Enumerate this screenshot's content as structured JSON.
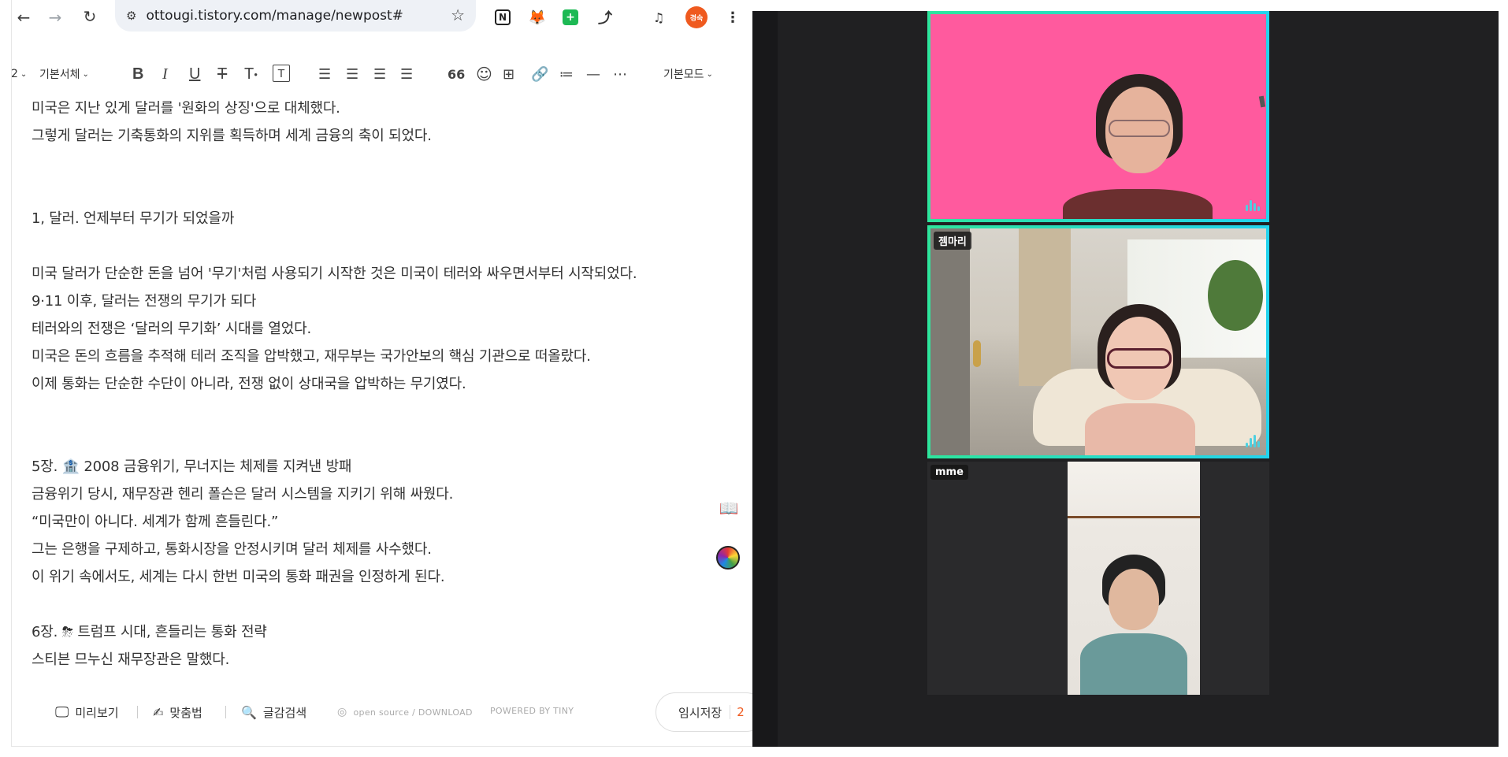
{
  "browser": {
    "url": "ottougi.tistory.com/manage/newpost#",
    "nav": {
      "back": "←",
      "forward": "→",
      "reload": "↻"
    },
    "profile_badge": "경숙"
  },
  "toolbar": {
    "heading_select": "2",
    "font_select": "기본서체",
    "mode_select": "기본모드",
    "bold": "B",
    "italic": "I",
    "underline": "U",
    "strike": "T",
    "text_color": "T",
    "text_bg": "T",
    "quote": "66"
  },
  "content": {
    "lines": [
      "미국은 지난 있게 달러를 '원화의 상징'으로 대체했다.",
      "그렇게 달러는 기축통화의 지위를 획득하며 세계 금융의 축이 되었다.",
      "",
      "",
      "1,  달러. 언제부터 무기가 되었을까",
      "",
      "미국 달러가 단순한 돈을 넘어 '무기'처럼 사용되기 시작한 것은 미국이  테러와 싸우면서부터 시작되었다.",
      "9·11 이후, 달러는 전쟁의 무기가 되다",
      "테러와의 전쟁은 ‘달러의 무기화’ 시대를 열었다.",
      "미국은 돈의 흐름을 추적해 테러 조직을 압박했고, 재무부는 국가안보의 핵심 기관으로 떠올랐다.",
      "이제 통화는 단순한 수단이 아니라, 전쟁 없이 상대국을 압박하는 무기였다.",
      "",
      "",
      "5장.  🏦  2008 금융위기, 무너지는 체제를 지켜낸 방패",
      "금융위기 당시, 재무장관 헨리 폴슨은 달러 시스템을 지키기 위해 싸웠다.",
      "“미국만이 아니다. 세계가 함께 흔들린다.”",
      "그는 은행을 구제하고, 통화시장을 안정시키며 달러 체제를 사수했다.",
      "이 위기 속에서도, 세계는 다시 한번 미국의 통화 패권을 인정하게 된다.",
      "",
      "6장. ⛈ 트럼프 시대, 흔들리는 통화 전략",
      "스티븐 므누신 재무장관은 말했다."
    ]
  },
  "footer": {
    "preview": "미리보기",
    "spellcheck": "맞춤법",
    "search": "글감검색",
    "opensource": "open source / DOWNLOAD",
    "powered": "POWERED BY TINY",
    "save": "임시저장",
    "save_count": "2"
  },
  "call": {
    "tiles": [
      {
        "name": ""
      },
      {
        "name": "젬마리"
      },
      {
        "name": "mme"
      }
    ]
  },
  "colors": {
    "tile1_bg": "#ff5a9e",
    "active_border": "#2ee59d",
    "accent_orange": "#ef5a1f"
  }
}
